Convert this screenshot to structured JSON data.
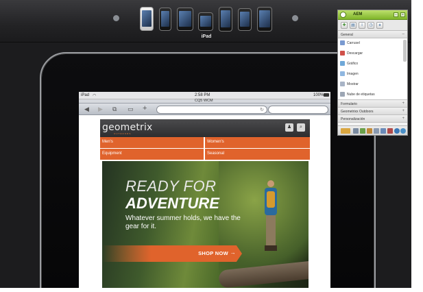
{
  "device_bar": {
    "devices": [
      {
        "icon": "android-phone-icon",
        "style": "white"
      },
      {
        "icon": "phone-icon",
        "style": "dark"
      },
      {
        "icon": "tablet-icon",
        "style": "dark"
      },
      {
        "icon": "ipad-icon",
        "style": "dark"
      },
      {
        "icon": "iphone-icon",
        "style": "dark"
      },
      {
        "icon": "phone-icon",
        "style": "dark"
      },
      {
        "icon": "blackberry-icon",
        "style": "dark"
      }
    ],
    "selected_label": "iPad"
  },
  "ipad": {
    "status_carrier": "iPad",
    "status_time": "2:58 PM",
    "status_battery": "100%",
    "browser_title": "CQ5 WCM"
  },
  "site": {
    "logo": "geometrix",
    "logo_sub": "OUTDOORS",
    "menu": [
      "Men's",
      "Women's",
      "Equipment",
      "Seasonal"
    ],
    "hero": {
      "line1": "READY FOR",
      "line2": "ADVENTURE",
      "subtitle": "Whatever summer holds, we have the gear for it.",
      "cta": "SHOP NOW",
      "cta_arrow": "→"
    }
  },
  "sidekick": {
    "title": "AEM",
    "sections": {
      "general": "General",
      "formulario": "Formulario",
      "geometrixx_outdoors": "Geometrixx Outdoors",
      "personalizacion": "Personalización"
    },
    "components": [
      "Carrusel",
      "Descargar",
      "Gráfico",
      "Imagen",
      "Mostrar",
      "Nube de etiquetas"
    ]
  },
  "colors": {
    "accent_orange": "#e0632c",
    "sidekick_green": "#8cbf35",
    "site_header": "#3a3a3c"
  }
}
